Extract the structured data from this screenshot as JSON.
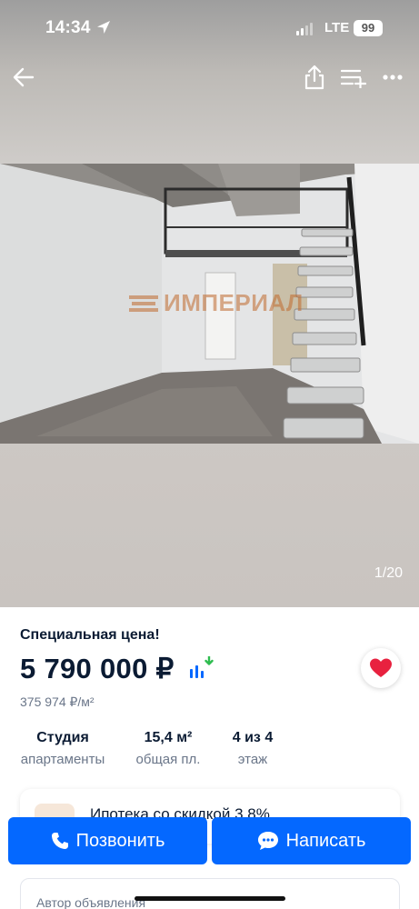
{
  "status_bar": {
    "time": "14:34",
    "network": "LTE",
    "battery": "99"
  },
  "gallery": {
    "counter": "1/20",
    "watermark": "ИМПЕРИАЛ",
    "icons": [
      "back-arrow-icon",
      "share-icon",
      "add-to-list-icon",
      "more-icon"
    ]
  },
  "offer": {
    "special_label": "Специальная цена!",
    "price": "5 790 000 ₽",
    "price_per_m": "375 974 ₽/м²",
    "favorite_color": "#e8213f"
  },
  "specs": [
    {
      "value": "Студия",
      "label": "апартаменты"
    },
    {
      "value": "15,4 м²",
      "label": "общая пл."
    },
    {
      "value": "4 из 4",
      "label": "этаж"
    }
  ],
  "mortgage": {
    "text": "Ипотека со скидкой 3,8%"
  },
  "actions": {
    "call_label": "Позвонить",
    "write_label": "Написать",
    "accent": "#0468ff"
  },
  "author": {
    "label": "Автор объявления"
  }
}
